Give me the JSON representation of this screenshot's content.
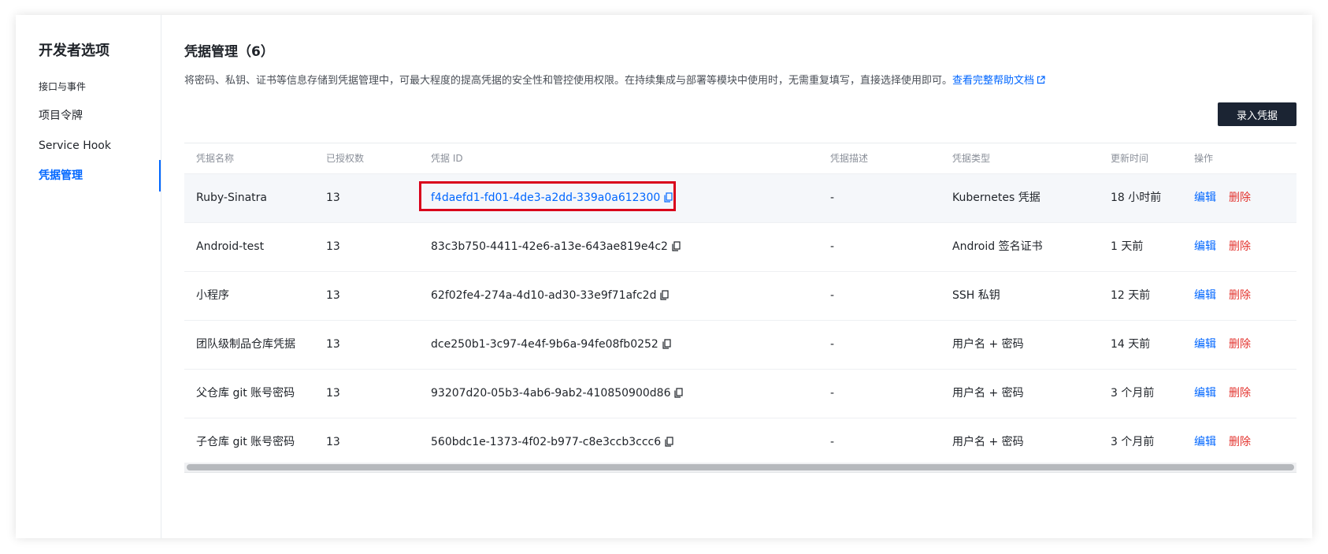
{
  "sidebar": {
    "title": "开发者选项",
    "items": [
      {
        "label": "接口与事件",
        "active": false
      },
      {
        "label": "项目令牌",
        "active": false
      },
      {
        "label": "Service Hook",
        "active": false
      },
      {
        "label": "凭据管理",
        "active": true
      }
    ]
  },
  "page": {
    "title": "凭据管理（6）",
    "description": "将密码、私钥、证书等信息存储到凭据管理中，可最大程度的提高凭据的安全性和管控使用权限。在持续集成与部署等模块中使用时，无需重复填写，直接选择使用即可。",
    "help_link": "查看完整帮助文档",
    "add_button": "录入凭据"
  },
  "table": {
    "columns": [
      "凭据名称",
      "已授权数",
      "凭据 ID",
      "凭据描述",
      "凭据类型",
      "更新时间",
      "操作"
    ],
    "rows": [
      {
        "name": "Ruby-Sinatra",
        "count": "13",
        "id": "f4daefd1-fd01-4de3-a2dd-339a0a612300",
        "desc": "-",
        "type": "Kubernetes 凭据",
        "updated": "18 小时前",
        "edit": "编辑",
        "delete": "删除"
      },
      {
        "name": "Android-test",
        "count": "13",
        "id": "83c3b750-4411-42e6-a13e-643ae819e4c2",
        "desc": "-",
        "type": "Android 签名证书",
        "updated": "1 天前",
        "edit": "编辑",
        "delete": "删除"
      },
      {
        "name": "小程序",
        "count": "13",
        "id": "62f02fe4-274a-4d10-ad30-33e9f71afc2d",
        "desc": "-",
        "type": "SSH 私钥",
        "updated": "12 天前",
        "edit": "编辑",
        "delete": "删除"
      },
      {
        "name": "团队级制品仓库凭据",
        "count": "13",
        "id": "dce250b1-3c97-4e4f-9b6a-94fe08fb0252",
        "desc": "-",
        "type": "用户名 + 密码",
        "updated": "14 天前",
        "edit": "编辑",
        "delete": "删除"
      },
      {
        "name": "父仓库 git 账号密码",
        "count": "13",
        "id": "93207d20-05b3-4ab6-9ab2-410850900d86",
        "desc": "-",
        "type": "用户名 + 密码",
        "updated": "3 个月前",
        "edit": "编辑",
        "delete": "删除"
      },
      {
        "name": "子仓库 git 账号密码",
        "count": "13",
        "id": "560bdc1e-1373-4f02-b977-c8e3ccb3ccc6",
        "desc": "-",
        "type": "用户名 + 密码",
        "updated": "3 个月前",
        "edit": "编辑",
        "delete": "删除"
      }
    ]
  },
  "colors": {
    "accent": "#0066ff",
    "danger": "#e3342f",
    "highlight_box": "#d9001b",
    "primary_button": "#1b2433"
  },
  "icons": {
    "external_link": "external-link-icon",
    "copy": "copy-icon"
  }
}
